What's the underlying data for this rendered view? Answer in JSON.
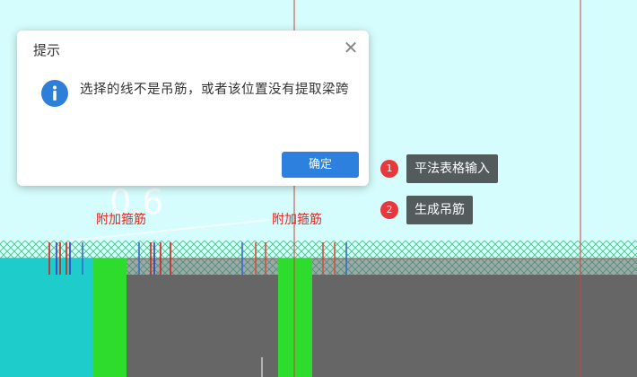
{
  "dialog": {
    "title": "提示",
    "close_symbol": "✕",
    "icon": "info-icon",
    "message": "选择的线不是吊筋，或者该位置没有提取梁跨",
    "ok_label": "确定"
  },
  "canvas": {
    "dimension_text": "0.6",
    "labels": [
      "附加箍筋",
      "附加箍筋"
    ]
  },
  "menu": [
    {
      "badge": "1",
      "label": "平法表格输入"
    },
    {
      "badge": "2",
      "label": "生成吊筋"
    }
  ],
  "colors": {
    "background": "#d6fdfd",
    "accent": "#2d80de",
    "badge": "#e8383d",
    "label_red": "#e8231d",
    "column_cyan": "#1ecccc",
    "column_green": "#2ddc2d",
    "beam_gray": "#666666"
  }
}
